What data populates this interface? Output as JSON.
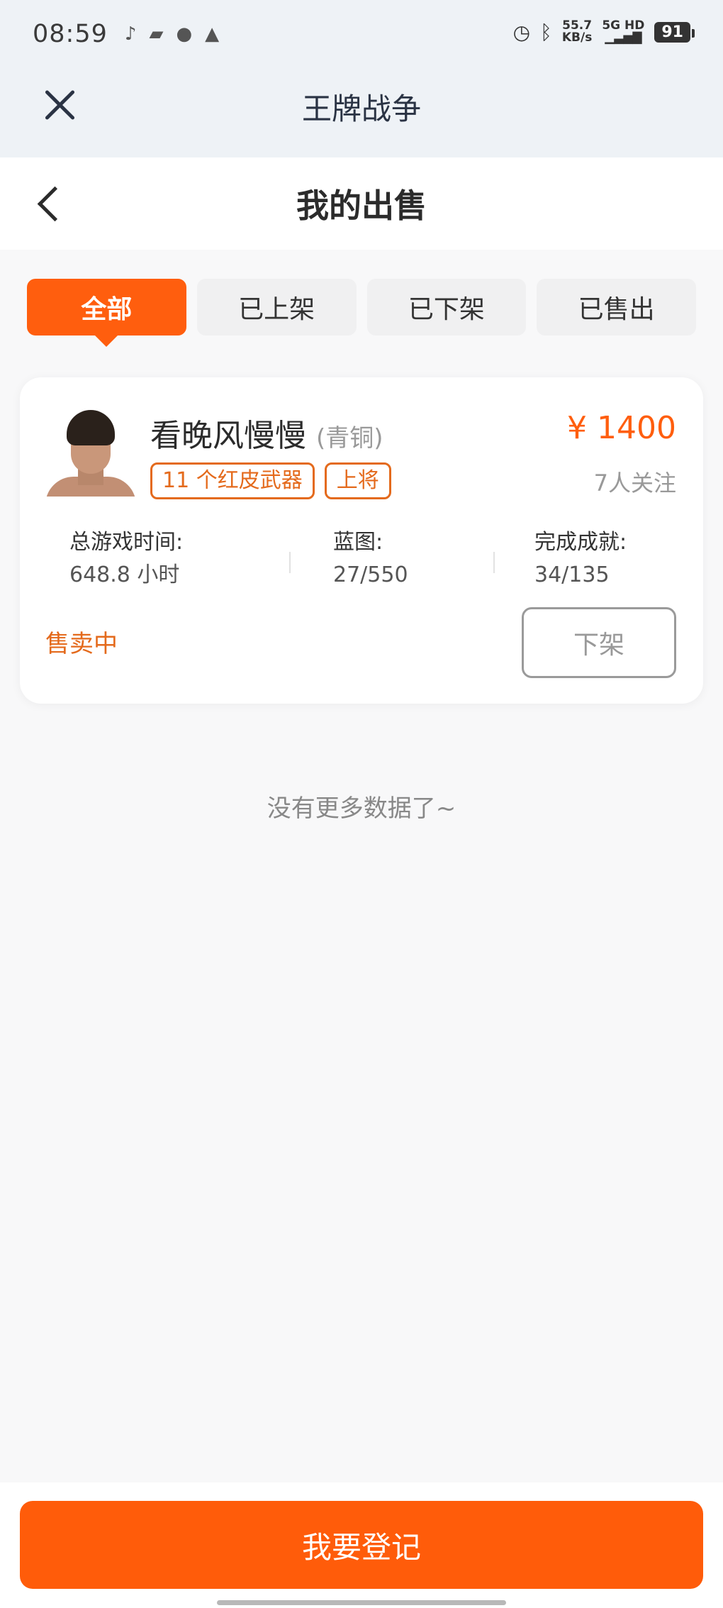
{
  "status_bar": {
    "time": "08:59",
    "left_icons": [
      "notification-icon",
      "app-icon",
      "location-icon",
      "warning-icon"
    ],
    "right_icons": [
      "alarm-icon",
      "bluetooth-icon",
      "signal-icon"
    ],
    "network_speed": "55.7",
    "network_unit": "KB/s",
    "network_type": "5G HD",
    "battery": "91"
  },
  "app_header": {
    "title": "王牌战争"
  },
  "page_header": {
    "title": "我的出售"
  },
  "tabs": [
    {
      "label": "全部",
      "active": true
    },
    {
      "label": "已上架",
      "active": false
    },
    {
      "label": "已下架",
      "active": false
    },
    {
      "label": "已售出",
      "active": false
    }
  ],
  "listing": {
    "name": "看晚风慢慢",
    "rank": "(青铜)",
    "tags": [
      "11 个红皮武器",
      "上将"
    ],
    "price": "¥ 1400",
    "followers": "7人关注",
    "stats": [
      {
        "label": "总游戏时间:",
        "value": "648.8 小时"
      },
      {
        "label": "蓝图:",
        "value": "27/550"
      },
      {
        "label": "完成成就:",
        "value": "34/135"
      }
    ],
    "status": "售卖中",
    "action_label": "下架"
  },
  "footer_note": "没有更多数据了~",
  "bottom": {
    "register_label": "我要登记"
  },
  "colors": {
    "accent": "#ff5e0e",
    "tag": "#e46a1c",
    "header_bg": "#eef2f6"
  }
}
